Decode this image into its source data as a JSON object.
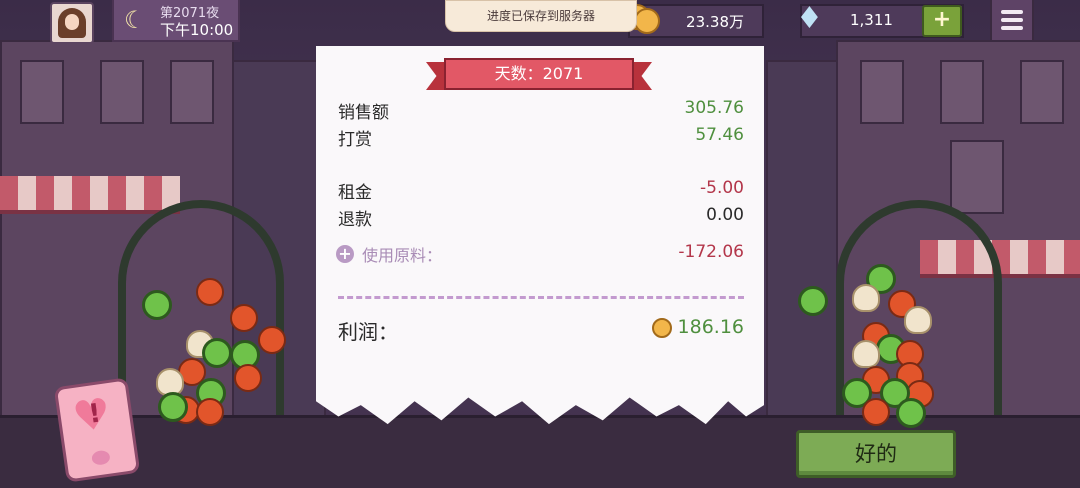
{
  "header": {
    "night_label": "第2071夜",
    "time_label": "下午10:00",
    "toast": "进度已保存到服务器",
    "coins": "23.38万",
    "gems": "1,311",
    "plus_label": "+"
  },
  "receipt": {
    "title": "天数：2071",
    "rows": [
      {
        "label": "销售额",
        "value": "305.76"
      },
      {
        "label": "打赏",
        "value": "57.46"
      },
      {
        "label": "租金",
        "value": "-5.00"
      },
      {
        "label": "退款",
        "value": "0.00"
      }
    ],
    "materials_label": "使用原料：",
    "materials_value": "-172.06",
    "profit_label": "利润：",
    "profit_value": "186.16"
  },
  "ok_button": "好的",
  "colors": {
    "positive": "#4f8f3e",
    "negative": "#b3364a",
    "ribbon": "#e25866",
    "button": "#7dab55"
  },
  "icons": [
    "avatar",
    "moon-icon",
    "coin-icon",
    "diamond-icon",
    "plus-icon",
    "menu-icon",
    "expand-plus-icon",
    "phone-heart-icon"
  ]
}
